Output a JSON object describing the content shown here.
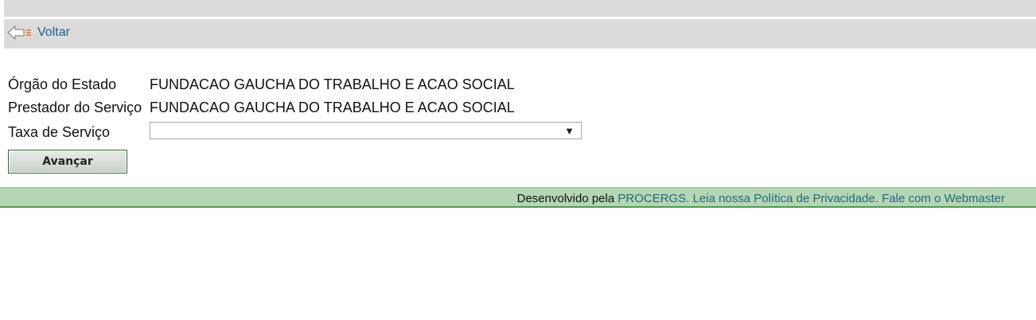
{
  "nav": {
    "back_label": "Voltar",
    "back_icon": "back-arrow-icon"
  },
  "form": {
    "orgao_label": "Órgão do Estado",
    "orgao_value": "FUNDACAO GAUCHA DO TRABALHO E ACAO SOCIAL",
    "prestador_label": "Prestador do Serviço",
    "prestador_value": "FUNDACAO GAUCHA DO TRABALHO E ACAO SOCIAL",
    "taxa_label": "Taxa de Serviço",
    "taxa_selected": "",
    "dropdown_arrow": "▼",
    "submit_label": "Avançar"
  },
  "footer": {
    "prefix": "Desenvolvido pela",
    "procergs_link": "PROCERGS.",
    "privacy_link": "Leia nossa Política de Privacidade.",
    "webmaster_link": "Fale com o Webmaster"
  },
  "colors": {
    "bar_gray": "#dcdbdc",
    "link_blue": "#1f5f8b",
    "footer_green": "#b5d6b5",
    "footer_link": "#1e6a7a"
  }
}
